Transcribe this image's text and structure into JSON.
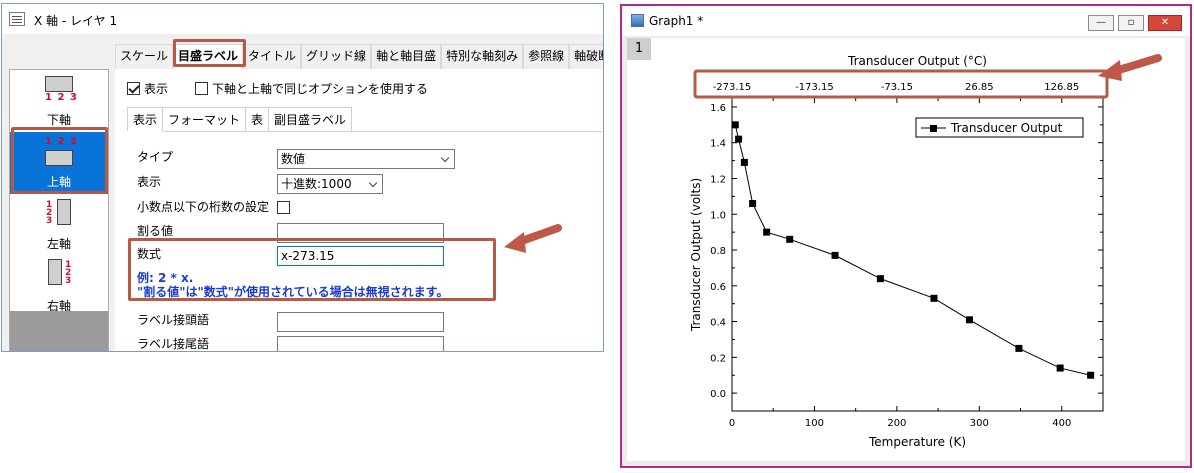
{
  "dialog": {
    "title": "X 軸 - レイヤ 1",
    "tabs": [
      "スケール",
      "目盛ラベル",
      "タイトル",
      "グリッド線",
      "軸と軸目盛",
      "特別な軸刻み",
      "参照線",
      "軸破断"
    ],
    "active_tab_index": 1,
    "axes": [
      {
        "label": "下軸",
        "nums": "1 2 3"
      },
      {
        "label": "上軸",
        "nums": "1 2 3"
      },
      {
        "label": "左軸",
        "nums": [
          "1",
          "2",
          "3"
        ]
      },
      {
        "label": "右軸",
        "nums": [
          "1",
          "2",
          "3"
        ]
      }
    ],
    "selected_axis_index": 1,
    "show_label": "表示",
    "show_checked": true,
    "same_options_label": "下軸と上軸で同じオプションを使用する",
    "same_options_checked": false,
    "subtabs": [
      "表示",
      "フォーマット",
      "表",
      "副目盛ラベル"
    ],
    "fields": {
      "type_label": "タイプ",
      "type_value": "数値",
      "display_label": "表示",
      "display_value": "十進数:1000",
      "decimals_label": "小数点以下の桁数の設定",
      "divide_label": "割る値",
      "divide_value": "",
      "formula_label": "数式",
      "formula_value": "x-273.15",
      "hint_line1": "例: 2 * x.",
      "hint_line2": "\"割る値\"は\"数式\"が使用されている場合は無視されます。",
      "prefix_label": "ラベル接頭語",
      "prefix_value": "",
      "suffix_label": "ラベル接尾語",
      "suffix_value": ""
    }
  },
  "graph": {
    "window_title": "Graph1 *",
    "layer_badge": "1",
    "colors": {
      "highlight": "#b55a45",
      "arrow": "#c0584a",
      "selected": "#0a73d9",
      "window_border": "#b02a8c"
    }
  },
  "chart_data": {
    "type": "line",
    "title": "",
    "xlabel": "Temperature (K)",
    "ylabel": "Transducer Output (volts)",
    "top_axis_label": "Transducer Output (°C)",
    "xlim": [
      0,
      450
    ],
    "ylim": [
      -0.1,
      1.65
    ],
    "x_ticks": [
      0,
      100,
      200,
      300,
      400
    ],
    "y_ticks": [
      0.0,
      0.2,
      0.4,
      0.6,
      0.8,
      1.0,
      1.2,
      1.4,
      1.6
    ],
    "top_ticks": [
      0,
      100,
      200,
      300,
      400
    ],
    "top_tick_labels": [
      "-273.15",
      "-173.15",
      "-73.15",
      "26.85",
      "126.85"
    ],
    "legend": "top-right",
    "grid": false,
    "series": [
      {
        "name": "Transducer Output",
        "marker": "square",
        "x": [
          4,
          8,
          15,
          25,
          42,
          70,
          125,
          180,
          245,
          288,
          348,
          398,
          435
        ],
        "y": [
          1.5,
          1.42,
          1.29,
          1.06,
          0.9,
          0.86,
          0.77,
          0.64,
          0.53,
          0.41,
          0.25,
          0.14,
          0.1
        ]
      }
    ]
  }
}
